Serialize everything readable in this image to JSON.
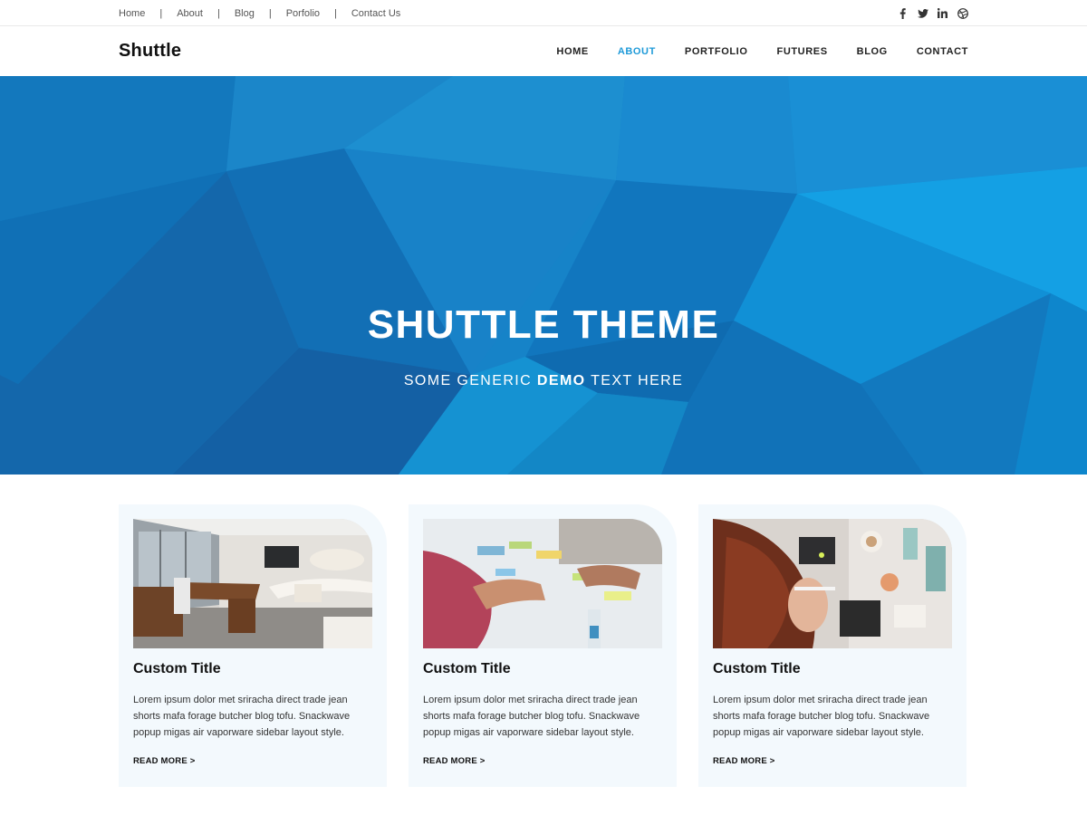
{
  "topbar": {
    "links": [
      "Home",
      "About",
      "Blog",
      "Porfolio",
      "Contact Us"
    ],
    "separator": "|",
    "social_icons": [
      "facebook-icon",
      "twitter-icon",
      "linkedin-icon",
      "dribbble-icon"
    ]
  },
  "nav": {
    "logo": "Shuttle",
    "items": [
      "HOME",
      "ABOUT",
      "PORTFOLIO",
      "FUTURES",
      "BLOG",
      "CONTACT"
    ],
    "active": "ABOUT"
  },
  "hero": {
    "title": "SHUTTLE THEME",
    "subtitle_before": "SOME GENERIC ",
    "subtitle_bold": "DEMO",
    "subtitle_after": " TEXT HERE"
  },
  "cards": [
    {
      "image": "office-room-photo",
      "title": "Custom Title",
      "text": "Lorem ipsum dolor met sriracha direct trade jean shorts mafa forage butcher blog tofu. Snackwave popup migas air vaporware sidebar layout style.",
      "link": "READ MORE >"
    },
    {
      "image": "team-meeting-photo",
      "title": "Custom Title",
      "text": "Lorem ipsum dolor met sriracha direct trade jean shorts mafa forage butcher blog tofu. Snackwave popup migas air vaporware sidebar layout style.",
      "link": "READ MORE >"
    },
    {
      "image": "woman-writing-photo",
      "title": "Custom Title",
      "text": "Lorem ipsum dolor met sriracha direct trade jean shorts mafa forage butcher blog tofu. Snackwave popup migas air vaporware sidebar layout style.",
      "link": "READ MORE >"
    }
  ],
  "colors": {
    "accent": "#1e9ad8",
    "hero_base": "#1683c8",
    "card_bg": "#f3f9fd"
  }
}
